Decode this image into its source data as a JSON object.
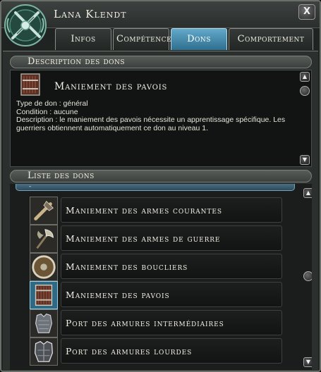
{
  "window": {
    "title": "Lana Klendt",
    "close_label": "X"
  },
  "tabs": [
    {
      "label": "Infos",
      "active": false
    },
    {
      "label": "Compétences",
      "active": false
    },
    {
      "label": "Dons",
      "active": true
    },
    {
      "label": "Comportement",
      "active": false
    }
  ],
  "description": {
    "header": "Description des dons",
    "feat_name": "Maniement des pavois",
    "type_line": "Type de don : général",
    "condition_line": "Condition : aucune",
    "description_line": "Description : le maniement des pavois nécessite un apprentissage spécifique. Les guerriers obtiennent automatiquement ce don au niveau 1."
  },
  "feat_list": {
    "header": "Liste des dons",
    "top_marker": "-",
    "items": [
      {
        "label": "Maniement des armes courantes",
        "icon": "simple-weapons-icon",
        "selected": false
      },
      {
        "label": "Maniement des armes de guerre",
        "icon": "martial-weapons-icon",
        "selected": false
      },
      {
        "label": "Maniement des boucliers",
        "icon": "shield-icon",
        "selected": false
      },
      {
        "label": "Maniement des pavois",
        "icon": "tower-shield-icon",
        "selected": true
      },
      {
        "label": "Port des armures intermédiaires",
        "icon": "medium-armor-icon",
        "selected": false
      },
      {
        "label": "Port des armures lourdes",
        "icon": "heavy-armor-icon",
        "selected": false
      }
    ]
  },
  "colors": {
    "accent_tab": "#3f8db3",
    "window_bg": "#1f2322"
  }
}
